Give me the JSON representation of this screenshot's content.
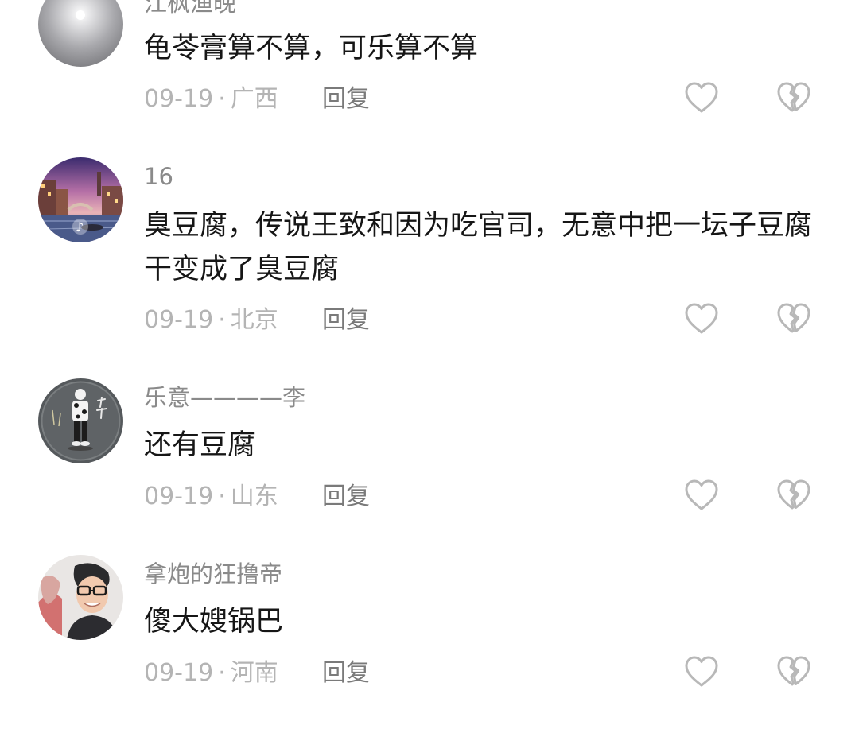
{
  "comments": [
    {
      "username": "江枫渔晚",
      "content": "龟苓膏算不算，可乐算不算",
      "date": "09-19",
      "separator": "·",
      "location": "广西",
      "reply_label": "回复",
      "avatar_icon": "gray-sphere-avatar",
      "like_icon": "heart-outline-icon",
      "dislike_icon": "broken-heart-icon"
    },
    {
      "username": "16",
      "content": "臭豆腐，传说王致和因为吃官司，无意中把一坛子豆腐干变成了臭豆腐",
      "date": "09-19",
      "separator": "·",
      "location": "北京",
      "reply_label": "回复",
      "avatar_icon": "canal-city-night-avatar",
      "like_icon": "heart-outline-icon",
      "dislike_icon": "broken-heart-icon"
    },
    {
      "username": "乐意————李",
      "content": "还有豆腐",
      "date": "09-19",
      "separator": "·",
      "location": "山东",
      "reply_label": "回复",
      "avatar_icon": "cartoon-figure-avatar",
      "like_icon": "heart-outline-icon",
      "dislike_icon": "broken-heart-icon"
    },
    {
      "username": "拿炮的狂撸帝",
      "content": "傻大嫂锅巴",
      "date": "09-19",
      "separator": "·",
      "location": "河南",
      "reply_label": "回复",
      "avatar_icon": "man-with-glasses-avatar",
      "like_icon": "heart-outline-icon",
      "dislike_icon": "broken-heart-icon"
    }
  ],
  "colors": {
    "username": "#8a8a8a",
    "content": "#161616",
    "meta": "#b4b4b4",
    "reply": "#7a7a7a",
    "icon": "#b8b8b8"
  }
}
